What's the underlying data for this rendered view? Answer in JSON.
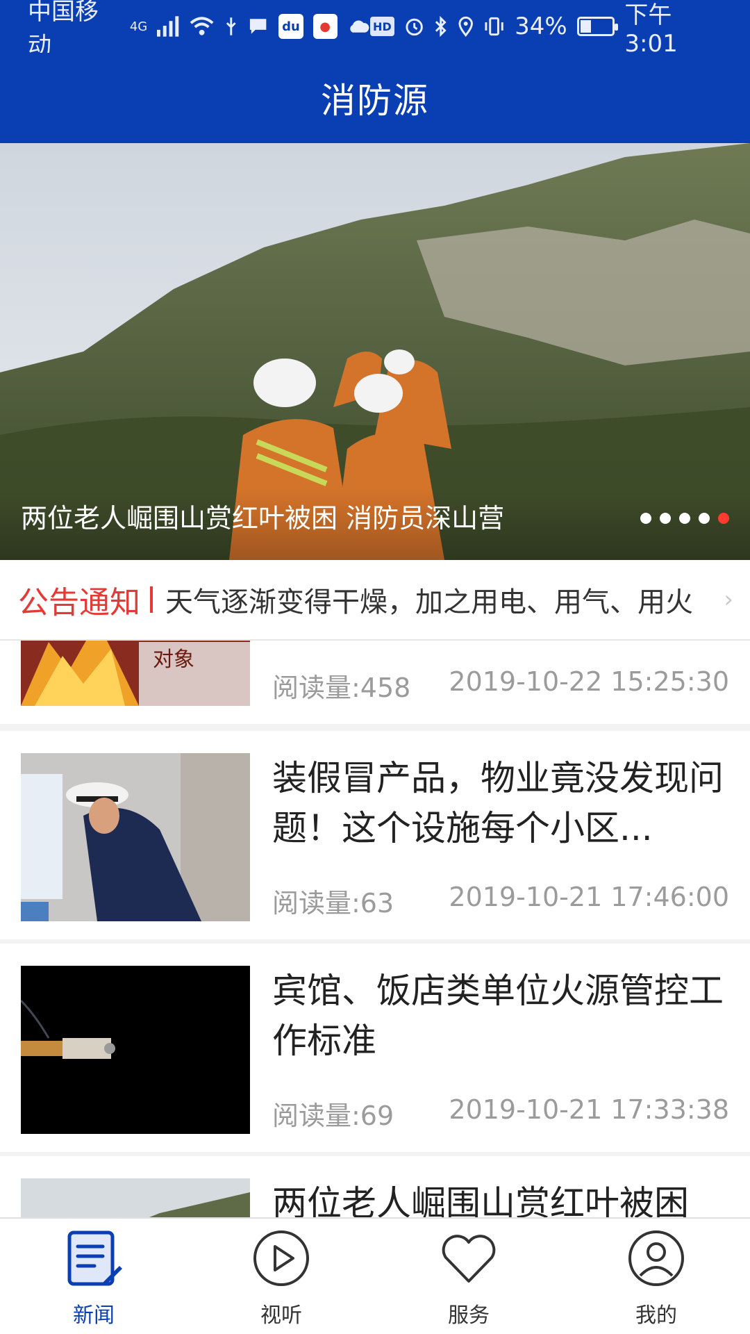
{
  "status_bar": {
    "carrier": "中国移动",
    "network": "4G",
    "battery": "34%",
    "battery_level": 0.34,
    "time": "下午3:01"
  },
  "header": {
    "title": "消防源"
  },
  "banner": {
    "caption": "两位老人崛围山赏红叶被困 消防员深山营",
    "dots": 5,
    "active_dot": 5
  },
  "notice": {
    "label": "公告通知",
    "text": "天气逐渐变得干燥，加之用电、用气、用火",
    "more_icon": "chevron-right-icon"
  },
  "news": [
    {
      "title": "",
      "reads": "阅读量:458",
      "date": "2019-10-22 15:25:30",
      "thumb": "fire-banner"
    },
    {
      "title": "装假冒产品，物业竟没发现问题！这个设施每个小区...",
      "reads": "阅读量:63",
      "date": "2019-10-21 17:46:00",
      "thumb": "officer-door"
    },
    {
      "title": "宾馆、饭店类单位火源管控工作标准",
      "reads": "阅读量:69",
      "date": "2019-10-21 17:33:38",
      "thumb": "cigarette"
    },
    {
      "title": "两位老人崛围山赏红叶被困",
      "reads": "",
      "date": "",
      "thumb": "mountain"
    }
  ],
  "tabs": [
    {
      "label": "新闻",
      "icon": "news-icon",
      "active": true
    },
    {
      "label": "视听",
      "icon": "play-icon",
      "active": false
    },
    {
      "label": "服务",
      "icon": "heart-icon",
      "active": false
    },
    {
      "label": "我的",
      "icon": "user-icon",
      "active": false
    }
  ],
  "colors": {
    "primary": "#0a3fb3",
    "notice_red": "#e53935",
    "dot_active": "#ff3b30"
  }
}
